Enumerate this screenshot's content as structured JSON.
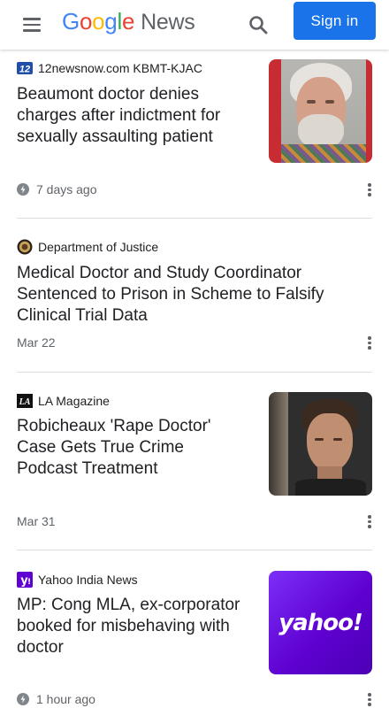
{
  "header": {
    "menu_icon": "hamburger-menu-icon",
    "logo": {
      "google_letters": [
        "G",
        "o",
        "o",
        "g",
        "l",
        "e"
      ],
      "news": "News"
    },
    "search_icon": "search-icon",
    "signin_label": "Sign in",
    "signin_color": "#1a73e8"
  },
  "articles": [
    {
      "source": "12newsnow.com KBMT-KJAC",
      "source_logo": "12news-logo-icon",
      "title": "Beaumont doctor denies charges after indictment for sexually assaulting patient",
      "time": "7 days ago",
      "time_icon": "lightning-bolt-icon",
      "thumbnail": "mugshot-older-man-photo"
    },
    {
      "source": "Department of Justice",
      "source_logo": "doj-seal-icon",
      "title": "Medical Doctor and Study Coordinator Sentenced to Prison in Scheme to Falsify Clinical Trial Data",
      "time": "Mar 22"
    },
    {
      "source": "LA Magazine",
      "source_logo": "la-magazine-logo-icon",
      "title": "Robicheaux 'Rape Doctor' Case Gets True Crime Podcast Treatment",
      "time": "Mar 31",
      "thumbnail": "mugshot-young-man-photo"
    },
    {
      "source": "Yahoo India News",
      "source_logo": "yahoo-y-icon",
      "title": "MP: Cong MLA, ex-corporator booked for misbehaving with doctor",
      "time": "1 hour ago",
      "time_icon": "lightning-bolt-icon",
      "thumbnail": "yahoo-logo-image",
      "thumbnail_text": "yahoo!"
    }
  ]
}
